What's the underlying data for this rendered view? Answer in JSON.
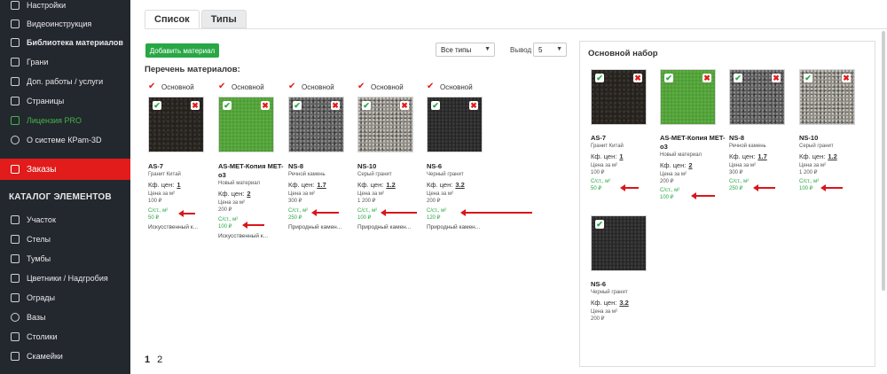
{
  "sidebar": {
    "items": [
      {
        "label": "Настройки",
        "icon": "settings-icon",
        "bold": false
      },
      {
        "label": "Видеоинструкция",
        "icon": "video-icon",
        "bold": false
      },
      {
        "label": "Библиотека материалов",
        "icon": "library-icon",
        "bold": true
      },
      {
        "label": "Грани",
        "icon": "facets-icon",
        "bold": false
      },
      {
        "label": "Доп. работы / услуги",
        "icon": "services-icon",
        "bold": false
      },
      {
        "label": "Страницы",
        "icon": "pages-icon",
        "bold": false
      },
      {
        "label": "Лицензия PRO",
        "icon": "license-icon",
        "bold": false
      },
      {
        "label": "О системе КРam-3D",
        "icon": "info-icon",
        "bold": false
      }
    ],
    "orders_label": "Заказы",
    "catalog_header": "КАТАЛОГ ЭЛЕМЕНТОВ",
    "catalog_items": [
      {
        "label": "Участок",
        "icon": "plot-icon"
      },
      {
        "label": "Стелы",
        "icon": "stele-icon"
      },
      {
        "label": "Тумбы",
        "icon": "pedestal-icon"
      },
      {
        "label": "Цветники / Надгробия",
        "icon": "flowerbed-icon"
      },
      {
        "label": "Ограды",
        "icon": "fence-icon"
      },
      {
        "label": "Вазы",
        "icon": "vase-icon"
      },
      {
        "label": "Столики",
        "icon": "table-icon"
      },
      {
        "label": "Скамейки",
        "icon": "bench-icon"
      }
    ],
    "accent_color": "#e21b1b",
    "license_color": "#43b649"
  },
  "tabs": [
    {
      "label": "Список",
      "active": true
    },
    {
      "label": "Типы",
      "active": false
    }
  ],
  "toolbar": {
    "add_label": "Добавить материал",
    "type_select": "Все типы",
    "output_label": "Вывод",
    "output_value": "5"
  },
  "list_title": "Перечень материалов:",
  "checkbox_label": "Основной",
  "labels": {
    "kf": "Кф. цен:",
    "price_label": "Цена за м²",
    "cost_label": "С/ст., м²"
  },
  "materials": [
    {
      "code": "AS-7",
      "desc": "Гранит Китай",
      "kf": "1",
      "price": "100 ₽",
      "cost": "50 ₽",
      "type": "Искусственный к..."
    },
    {
      "code": "AS-MET-Копия MET-o3",
      "desc": "Новый материал",
      "kf": "2",
      "price": "200 ₽",
      "cost": "100 ₽",
      "type": "Искусственный к..."
    },
    {
      "code": "NS-8",
      "desc": "Речной камень",
      "kf": "1.7",
      "price": "300 ₽",
      "cost": "250 ₽",
      "type": "Природный камен..."
    },
    {
      "code": "NS-10",
      "desc": "Серый гранит",
      "kf": "1.2",
      "price": "1 200 ₽",
      "cost": "100 ₽",
      "type": "Природный камен..."
    },
    {
      "code": "NS-6",
      "desc": "Черный гранит",
      "kf": "3.2",
      "price": "200 ₽",
      "cost": "120 ₽",
      "type": "Природный камен..."
    }
  ],
  "panel": {
    "title": "Основной набор",
    "items": [
      {
        "code": "AS-7",
        "desc": "Гранит Китай",
        "kf": "1",
        "price": "100 ₽",
        "cost": "50 ₽"
      },
      {
        "code": "AS-MET-Копия MET-o3",
        "desc": "Новый материал",
        "kf": "2",
        "price": "200 ₽",
        "cost": "100 ₽"
      },
      {
        "code": "NS-8",
        "desc": "Речной камень",
        "kf": "1.7",
        "price": "300 ₽",
        "cost": "250 ₽"
      },
      {
        "code": "NS-10",
        "desc": "Серый гранит",
        "kf": "1.2",
        "price": "1 200 ₽",
        "cost": "100 ₽"
      },
      {
        "code": "NS-6",
        "desc": "Черный гранит",
        "kf": "3.2",
        "price": "200 ₽"
      }
    ]
  },
  "pagination": {
    "pages": [
      "1",
      "2"
    ],
    "current": "1"
  }
}
